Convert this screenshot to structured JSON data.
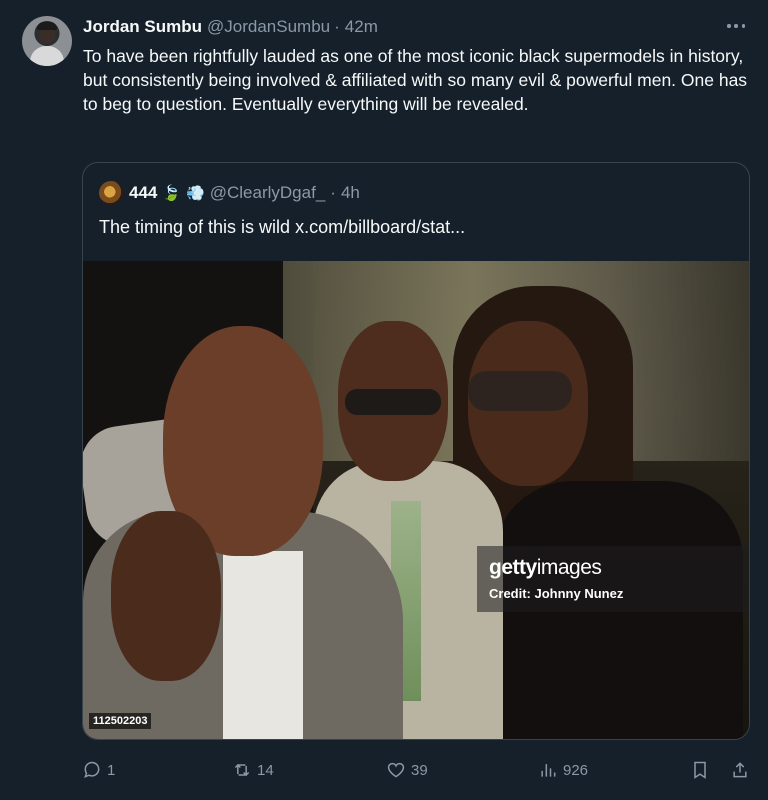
{
  "tweet": {
    "author_name": "Jordan Sumbu",
    "author_handle": "@JordanSumbu",
    "separator": "·",
    "time": "42m",
    "text": "To have been rightfully lauded as one of the most iconic black supermodels in history, but consistently being involved & affiliated with so many evil & powerful men. One has to beg to question. Eventually everything will be revealed."
  },
  "quote": {
    "author_name": "444",
    "emoji_1": "🍃",
    "emoji_2": "💨",
    "author_handle": "@ClearlyDgaf_",
    "separator": "·",
    "time": "4h",
    "text": "The timing of this is wild  x.com/billboard/stat...",
    "image": {
      "watermark_brand_bold": "getty",
      "watermark_brand_rest": "images",
      "watermark_credit": "Credit: Johnny Nunez",
      "image_id": "112502203"
    }
  },
  "actions": {
    "reply_count": "1",
    "retweet_count": "14",
    "like_count": "39",
    "view_count": "926"
  },
  "icons": [
    "more-icon",
    "reply-icon",
    "retweet-icon",
    "like-icon",
    "views-icon",
    "bookmark-icon",
    "share-icon"
  ],
  "colors": {
    "background": "#15202b",
    "text": "#f7f9f9",
    "secondary_text": "#8b98a5",
    "border": "#38444d"
  }
}
